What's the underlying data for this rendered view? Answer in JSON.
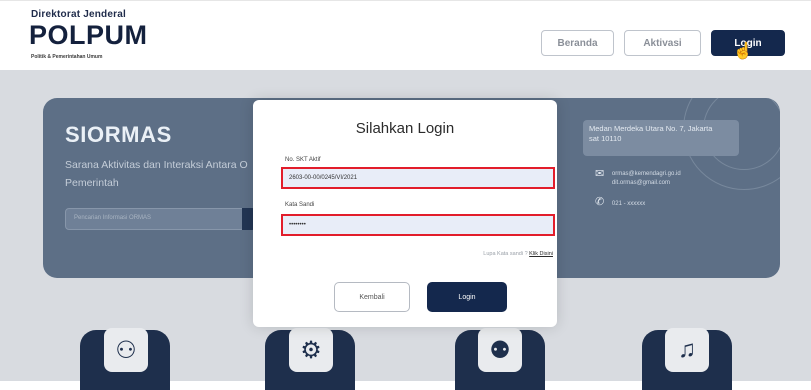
{
  "header": {
    "org_line": "Direktorat Jenderal",
    "logo": "POLPUM",
    "org_sub": "Politik & Pemerintahan Umum",
    "nav": [
      "Beranda",
      "Aktivasi",
      "Login"
    ]
  },
  "hero": {
    "title": "SIORMAS",
    "subtitle_line1": "Sarana Aktivitas dan Interaksi Antara O",
    "subtitle_line2": "Pemerintah",
    "search_placeholder": "Pencarian Informasi ORMAS",
    "address_line1": "Medan Merdeka Utara No. 7, Jakarta",
    "address_line2": "sat 10110",
    "email1": "ormas@kemendagri.go.id",
    "email2": "dit.ormas@gmail.com",
    "phone": "021 - xxxxxx"
  },
  "modal": {
    "title": "Silahkan Login",
    "skt_label": "No. SKT Aktif",
    "skt_value": "2603-00-00/0245/VI/2021",
    "password_label": "Kata Sandi",
    "password_value": "••••••••",
    "forgot_text": "Lupa Kata sandi ?",
    "forgot_link": "Klik Disini",
    "back_button": "Kembali",
    "login_button": "Login"
  },
  "colors": {
    "navy": "#14284d",
    "highlight": "#e21d2b"
  },
  "icons": [
    "hand-coin-icon",
    "hand-gear-icon",
    "people-meeting-icon",
    "hands-bell-icon",
    "mail-icon",
    "phone-icon",
    "cursor-hand-icon"
  ]
}
